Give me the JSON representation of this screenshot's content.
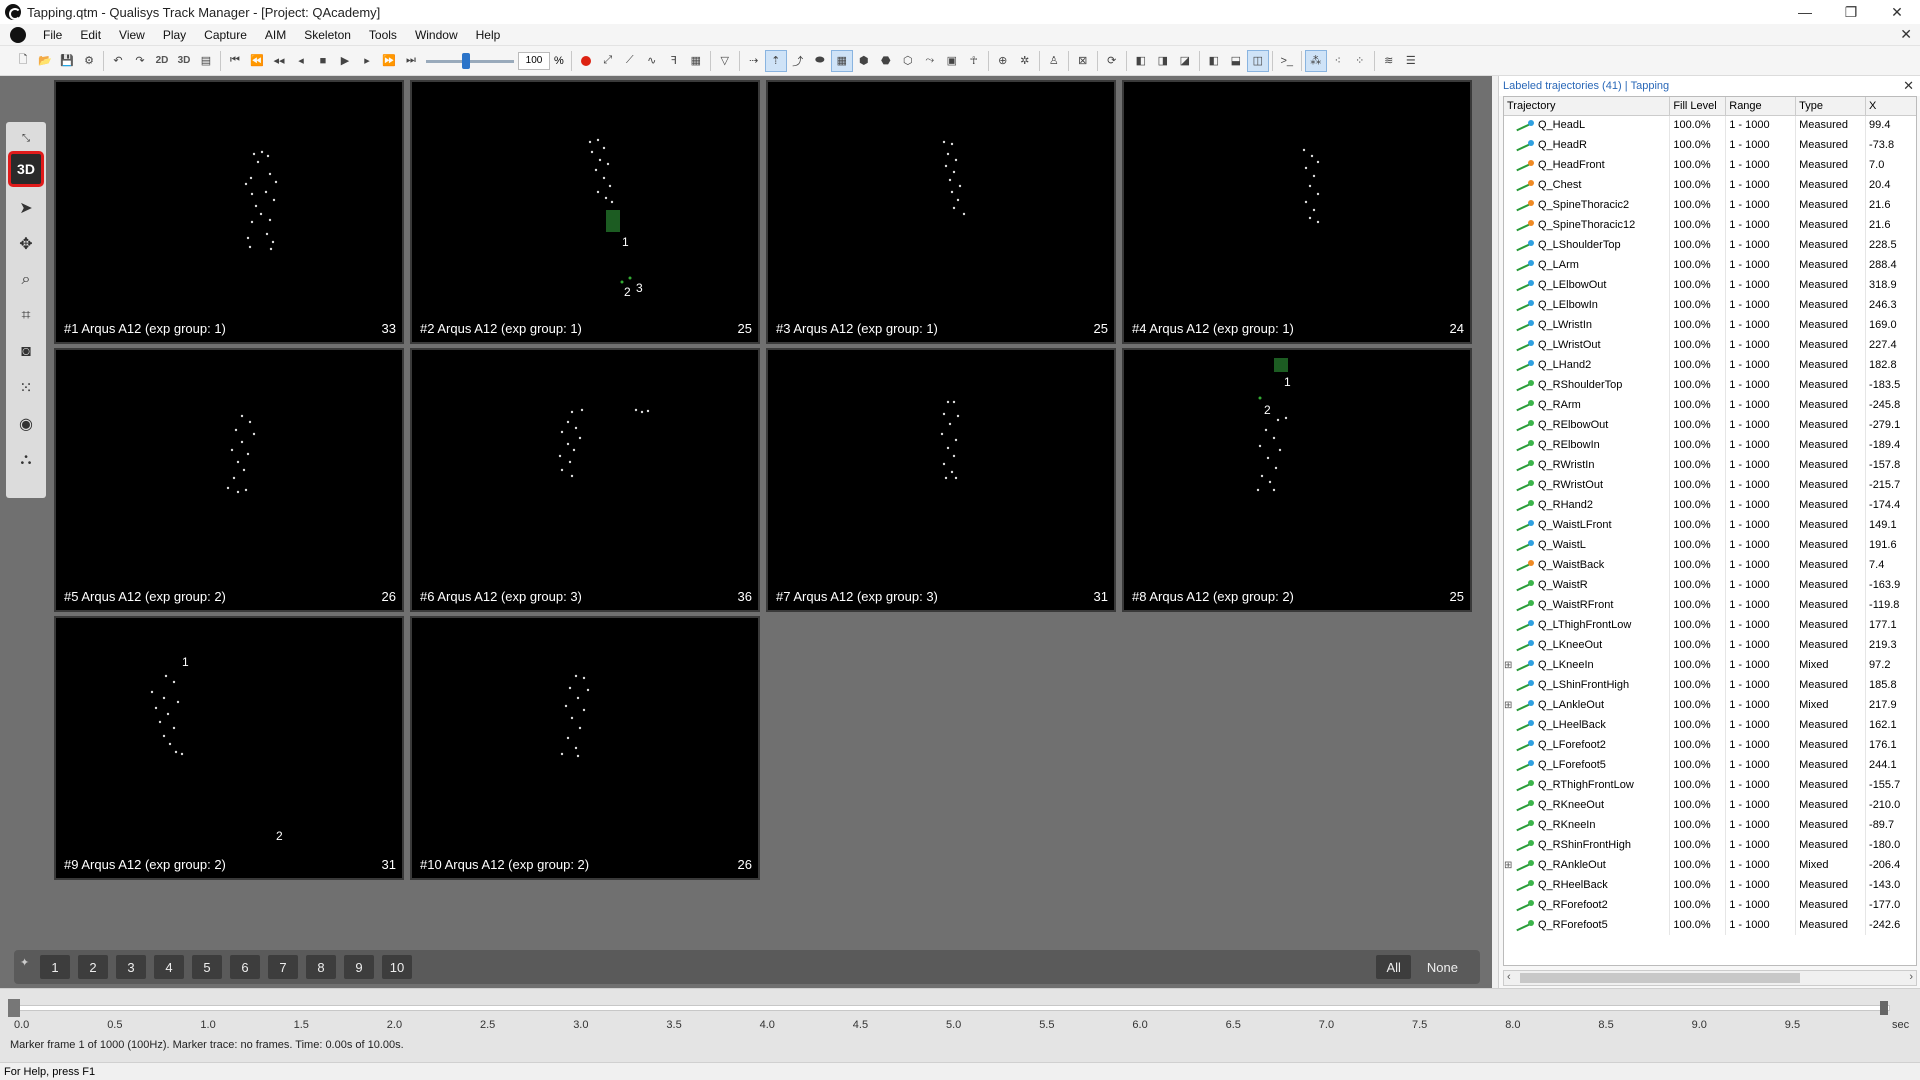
{
  "window": {
    "title": "Tapping.qtm - Qualisys Track Manager - [Project: QAcademy]",
    "controls": [
      "—",
      "❐",
      "✕"
    ]
  },
  "menu": [
    "File",
    "Edit",
    "View",
    "Play",
    "Capture",
    "AIM",
    "Skeleton",
    "Tools",
    "Window",
    "Help"
  ],
  "toolbar": {
    "view_2d": "2D",
    "view_3d": "3D",
    "speed_value": "100",
    "speed_unit": "%"
  },
  "left_tools": {
    "active_view": "3D"
  },
  "cameras": [
    {
      "label": "#1 Arqus A12 (exp group: 1)",
      "count": "33"
    },
    {
      "label": "#2 Arqus A12 (exp group: 1)",
      "count": "25"
    },
    {
      "label": "#3 Arqus A12 (exp group: 1)",
      "count": "25"
    },
    {
      "label": "#4 Arqus A12 (exp group: 1)",
      "count": "24"
    },
    {
      "label": "#5 Arqus A12 (exp group: 2)",
      "count": "26"
    },
    {
      "label": "#6 Arqus A12 (exp group: 3)",
      "count": "36"
    },
    {
      "label": "#7 Arqus A12 (exp group: 3)",
      "count": "31"
    },
    {
      "label": "#8 Arqus A12 (exp group: 2)",
      "count": "25"
    },
    {
      "label": "#9 Arqus A12 (exp group: 2)",
      "count": "31"
    },
    {
      "label": "#10 Arqus A12 (exp group: 2)",
      "count": "26"
    }
  ],
  "camera_markers": {
    "cam2": [
      "1",
      "2",
      "3"
    ],
    "cam8": [
      "1",
      "2"
    ],
    "cam9": [
      "1",
      "2"
    ]
  },
  "camera_buttons": [
    "1",
    "2",
    "3",
    "4",
    "5",
    "6",
    "7",
    "8",
    "9",
    "10"
  ],
  "camera_selection": {
    "all": "All",
    "none": "None"
  },
  "trajectory_panel": {
    "title": "Labeled trajectories (41)",
    "separator": "|",
    "file": "Tapping",
    "columns": [
      "Trajectory",
      "Fill Level",
      "Range",
      "Type",
      "X"
    ],
    "rows": [
      {
        "name": "Q_HeadL",
        "fill": "100.0%",
        "range": "1 - 1000",
        "type": "Measured",
        "x": "99.4",
        "color": "#2fa0e0",
        "expand": ""
      },
      {
        "name": "Q_HeadR",
        "fill": "100.0%",
        "range": "1 - 1000",
        "type": "Measured",
        "x": "-73.8",
        "color": "#2fa0e0",
        "expand": ""
      },
      {
        "name": "Q_HeadFront",
        "fill": "100.0%",
        "range": "1 - 1000",
        "type": "Measured",
        "x": "7.0",
        "color": "#f08a24",
        "expand": ""
      },
      {
        "name": "Q_Chest",
        "fill": "100.0%",
        "range": "1 - 1000",
        "type": "Measured",
        "x": "20.4",
        "color": "#f08a24",
        "expand": ""
      },
      {
        "name": "Q_SpineThoracic2",
        "fill": "100.0%",
        "range": "1 - 1000",
        "type": "Measured",
        "x": "21.6",
        "color": "#f08a24",
        "expand": ""
      },
      {
        "name": "Q_SpineThoracic12",
        "fill": "100.0%",
        "range": "1 - 1000",
        "type": "Measured",
        "x": "21.6",
        "color": "#f08a24",
        "expand": ""
      },
      {
        "name": "Q_LShoulderTop",
        "fill": "100.0%",
        "range": "1 - 1000",
        "type": "Measured",
        "x": "228.5",
        "color": "#2fa0e0",
        "expand": ""
      },
      {
        "name": "Q_LArm",
        "fill": "100.0%",
        "range": "1 - 1000",
        "type": "Measured",
        "x": "288.4",
        "color": "#2fa0e0",
        "expand": ""
      },
      {
        "name": "Q_LElbowOut",
        "fill": "100.0%",
        "range": "1 - 1000",
        "type": "Measured",
        "x": "318.9",
        "color": "#2fa0e0",
        "expand": ""
      },
      {
        "name": "Q_LElbowIn",
        "fill": "100.0%",
        "range": "1 - 1000",
        "type": "Measured",
        "x": "246.3",
        "color": "#2fa0e0",
        "expand": ""
      },
      {
        "name": "Q_LWristIn",
        "fill": "100.0%",
        "range": "1 - 1000",
        "type": "Measured",
        "x": "169.0",
        "color": "#2fa0e0",
        "expand": ""
      },
      {
        "name": "Q_LWristOut",
        "fill": "100.0%",
        "range": "1 - 1000",
        "type": "Measured",
        "x": "227.4",
        "color": "#2fa0e0",
        "expand": ""
      },
      {
        "name": "Q_LHand2",
        "fill": "100.0%",
        "range": "1 - 1000",
        "type": "Measured",
        "x": "182.8",
        "color": "#2fa0e0",
        "expand": ""
      },
      {
        "name": "Q_RShoulderTop",
        "fill": "100.0%",
        "range": "1 - 1000",
        "type": "Measured",
        "x": "-183.5",
        "color": "#3cb44b",
        "expand": ""
      },
      {
        "name": "Q_RArm",
        "fill": "100.0%",
        "range": "1 - 1000",
        "type": "Measured",
        "x": "-245.8",
        "color": "#3cb44b",
        "expand": ""
      },
      {
        "name": "Q_RElbowOut",
        "fill": "100.0%",
        "range": "1 - 1000",
        "type": "Measured",
        "x": "-279.1",
        "color": "#3cb44b",
        "expand": ""
      },
      {
        "name": "Q_RElbowIn",
        "fill": "100.0%",
        "range": "1 - 1000",
        "type": "Measured",
        "x": "-189.4",
        "color": "#3cb44b",
        "expand": ""
      },
      {
        "name": "Q_RWristIn",
        "fill": "100.0%",
        "range": "1 - 1000",
        "type": "Measured",
        "x": "-157.8",
        "color": "#3cb44b",
        "expand": ""
      },
      {
        "name": "Q_RWristOut",
        "fill": "100.0%",
        "range": "1 - 1000",
        "type": "Measured",
        "x": "-215.7",
        "color": "#3cb44b",
        "expand": ""
      },
      {
        "name": "Q_RHand2",
        "fill": "100.0%",
        "range": "1 - 1000",
        "type": "Measured",
        "x": "-174.4",
        "color": "#3cb44b",
        "expand": ""
      },
      {
        "name": "Q_WaistLFront",
        "fill": "100.0%",
        "range": "1 - 1000",
        "type": "Measured",
        "x": "149.1",
        "color": "#2fa0e0",
        "expand": ""
      },
      {
        "name": "Q_WaistL",
        "fill": "100.0%",
        "range": "1 - 1000",
        "type": "Measured",
        "x": "191.6",
        "color": "#2fa0e0",
        "expand": ""
      },
      {
        "name": "Q_WaistBack",
        "fill": "100.0%",
        "range": "1 - 1000",
        "type": "Measured",
        "x": "7.4",
        "color": "#f08a24",
        "expand": ""
      },
      {
        "name": "Q_WaistR",
        "fill": "100.0%",
        "range": "1 - 1000",
        "type": "Measured",
        "x": "-163.9",
        "color": "#3cb44b",
        "expand": ""
      },
      {
        "name": "Q_WaistRFront",
        "fill": "100.0%",
        "range": "1 - 1000",
        "type": "Measured",
        "x": "-119.8",
        "color": "#3cb44b",
        "expand": ""
      },
      {
        "name": "Q_LThighFrontLow",
        "fill": "100.0%",
        "range": "1 - 1000",
        "type": "Measured",
        "x": "177.1",
        "color": "#2fa0e0",
        "expand": ""
      },
      {
        "name": "Q_LKneeOut",
        "fill": "100.0%",
        "range": "1 - 1000",
        "type": "Measured",
        "x": "219.3",
        "color": "#2fa0e0",
        "expand": ""
      },
      {
        "name": "Q_LKneeIn",
        "fill": "100.0%",
        "range": "1 - 1000",
        "type": "Mixed",
        "x": "97.2",
        "color": "#2fa0e0",
        "expand": "⊞"
      },
      {
        "name": "Q_LShinFrontHigh",
        "fill": "100.0%",
        "range": "1 - 1000",
        "type": "Measured",
        "x": "185.8",
        "color": "#2fa0e0",
        "expand": ""
      },
      {
        "name": "Q_LAnkleOut",
        "fill": "100.0%",
        "range": "1 - 1000",
        "type": "Mixed",
        "x": "217.9",
        "color": "#2fa0e0",
        "expand": "⊞"
      },
      {
        "name": "Q_LHeelBack",
        "fill": "100.0%",
        "range": "1 - 1000",
        "type": "Measured",
        "x": "162.1",
        "color": "#2fa0e0",
        "expand": ""
      },
      {
        "name": "Q_LForefoot2",
        "fill": "100.0%",
        "range": "1 - 1000",
        "type": "Measured",
        "x": "176.1",
        "color": "#2fa0e0",
        "expand": ""
      },
      {
        "name": "Q_LForefoot5",
        "fill": "100.0%",
        "range": "1 - 1000",
        "type": "Measured",
        "x": "244.1",
        "color": "#2fa0e0",
        "expand": ""
      },
      {
        "name": "Q_RThighFrontLow",
        "fill": "100.0%",
        "range": "1 - 1000",
        "type": "Measured",
        "x": "-155.7",
        "color": "#3cb44b",
        "expand": ""
      },
      {
        "name": "Q_RKneeOut",
        "fill": "100.0%",
        "range": "1 - 1000",
        "type": "Measured",
        "x": "-210.0",
        "color": "#3cb44b",
        "expand": ""
      },
      {
        "name": "Q_RKneeIn",
        "fill": "100.0%",
        "range": "1 - 1000",
        "type": "Measured",
        "x": "-89.7",
        "color": "#3cb44b",
        "expand": ""
      },
      {
        "name": "Q_RShinFrontHigh",
        "fill": "100.0%",
        "range": "1 - 1000",
        "type": "Measured",
        "x": "-180.0",
        "color": "#3cb44b",
        "expand": ""
      },
      {
        "name": "Q_RAnkleOut",
        "fill": "100.0%",
        "range": "1 - 1000",
        "type": "Mixed",
        "x": "-206.4",
        "color": "#3cb44b",
        "expand": "⊞"
      },
      {
        "name": "Q_RHeelBack",
        "fill": "100.0%",
        "range": "1 - 1000",
        "type": "Measured",
        "x": "-143.0",
        "color": "#3cb44b",
        "expand": ""
      },
      {
        "name": "Q_RForefoot2",
        "fill": "100.0%",
        "range": "1 - 1000",
        "type": "Measured",
        "x": "-177.0",
        "color": "#3cb44b",
        "expand": ""
      },
      {
        "name": "Q_RForefoot5",
        "fill": "100.0%",
        "range": "1 - 1000",
        "type": "Measured",
        "x": "-242.6",
        "color": "#3cb44b",
        "expand": ""
      }
    ]
  },
  "timeline": {
    "ticks": [
      "0.0",
      "0.5",
      "1.0",
      "1.5",
      "2.0",
      "2.5",
      "3.0",
      "3.5",
      "4.0",
      "4.5",
      "5.0",
      "5.5",
      "6.0",
      "6.5",
      "7.0",
      "7.5",
      "8.0",
      "8.5",
      "9.0",
      "9.5",
      "sec"
    ],
    "status": "Marker frame 1 of 1000 (100Hz). Marker trace: no frames. Time: 0.00s of 10.00s."
  },
  "statusbar": "For Help, press F1"
}
